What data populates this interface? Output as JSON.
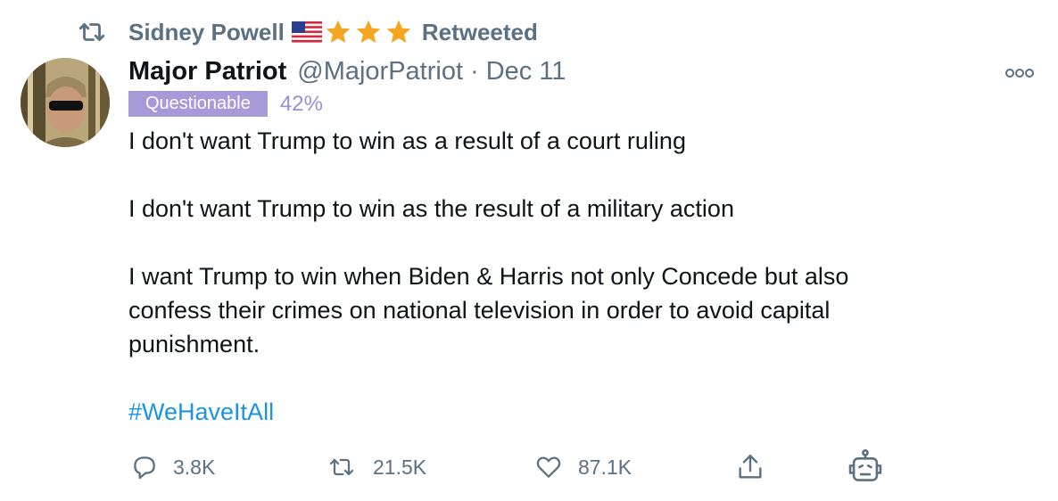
{
  "retweet_header": {
    "name": "Sidney Powell",
    "label": "Retweeted"
  },
  "tweet": {
    "display_name": "Major Patriot",
    "handle": "@MajorPatriot",
    "separator": "·",
    "date": "Dec 11",
    "badge": {
      "label": "Questionable",
      "percent": "42%"
    },
    "lines": [
      "I don't want Trump to win as a result of a court ruling",
      "I don't want Trump to win as the result of a military action",
      "I want Trump to win when Biden & Harris not only Concede but also",
      "confess their crimes on national television in order to avoid capital",
      "punishment."
    ],
    "hashtag": "#WeHaveItAll"
  },
  "actions": {
    "replies": "3.8K",
    "retweets": "21.5K",
    "likes": "87.1K"
  },
  "colors": {
    "secondary_text": "#5b7083",
    "hashtag": "#1b95e0",
    "badge_bg": "#a79ad9",
    "badge_pct": "#9a8fd6",
    "star": "#f4a623"
  },
  "icons": [
    "retweet-icon",
    "us-flag-icon",
    "star-icon",
    "more-icon",
    "reply-icon",
    "heart-icon",
    "share-icon",
    "bot-icon"
  ]
}
